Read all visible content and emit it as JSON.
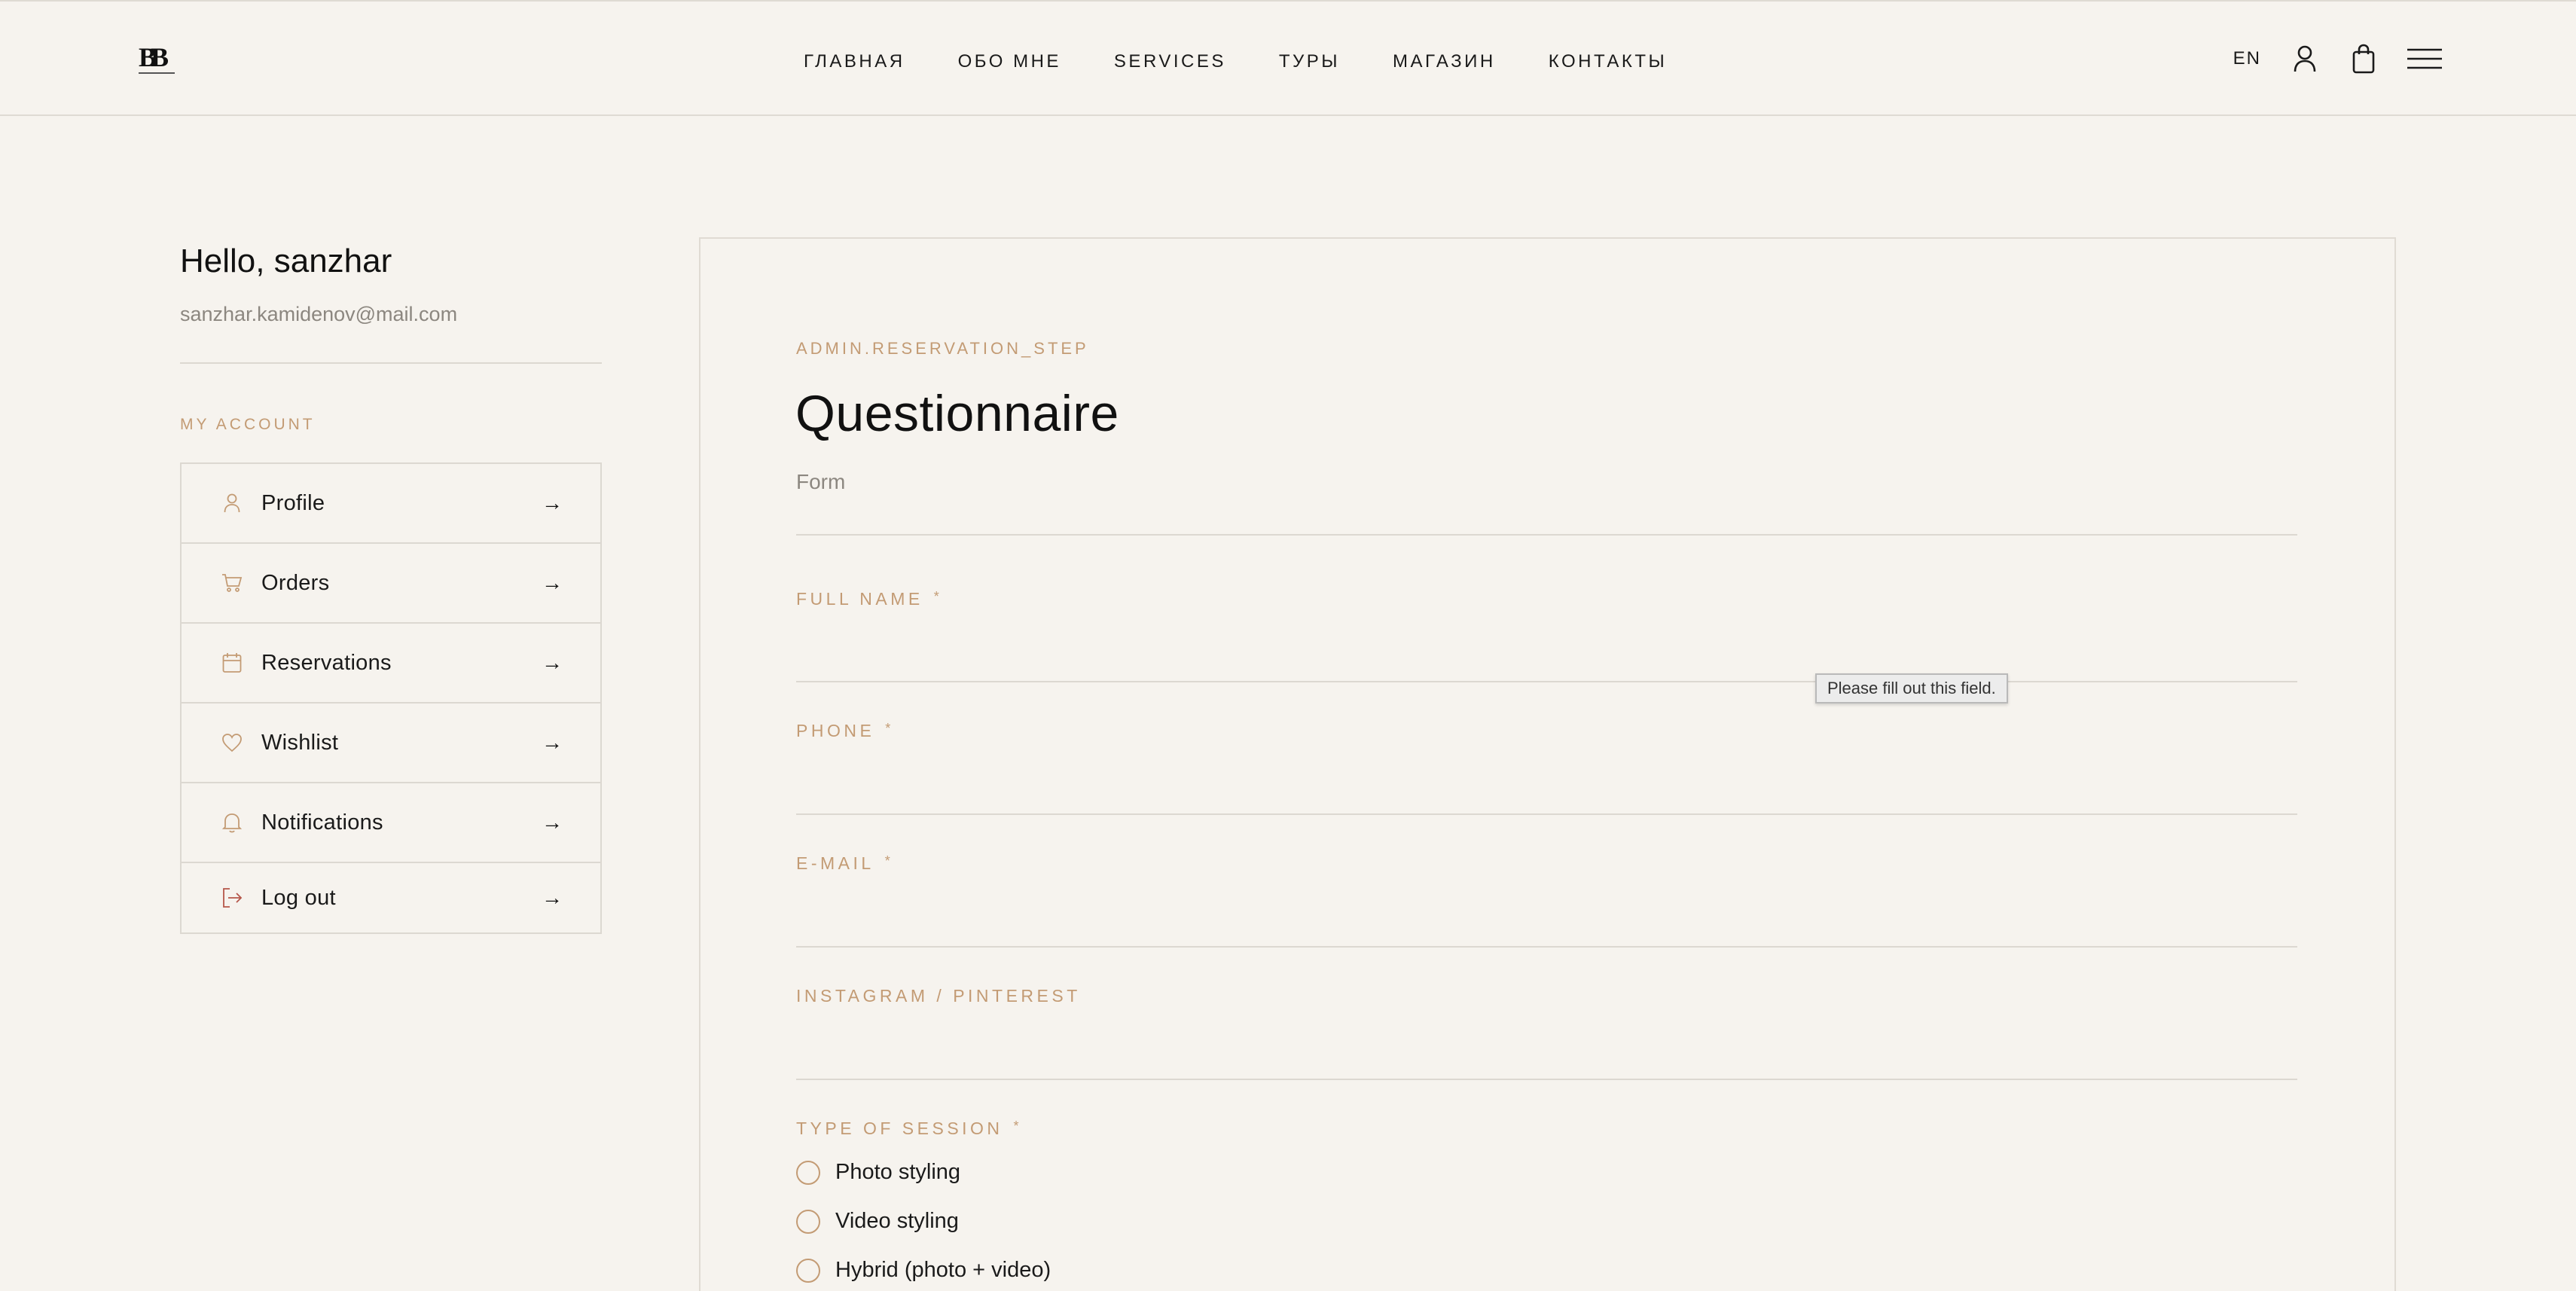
{
  "header": {
    "logo_text": "BB",
    "nav": [
      "ГЛАВНАЯ",
      "ОБО МНЕ",
      "SERVICES",
      "ТУРЫ",
      "МАГАЗИН",
      "КОНТАКТЫ"
    ],
    "lang": "EN",
    "icons": [
      "user-icon",
      "shopping-bag-icon",
      "hamburger-menu-icon"
    ]
  },
  "sidebar": {
    "greeting": "Hello, sanzhar",
    "email": "sanzhar.kamidenov@mail.com",
    "section_label": "MY ACCOUNT",
    "items": [
      {
        "label": "Profile",
        "icon": "user-icon",
        "arrow": "→"
      },
      {
        "label": "Orders",
        "icon": "cart-icon",
        "arrow": "→"
      },
      {
        "label": "Reservations",
        "icon": "calendar-icon",
        "arrow": "→"
      },
      {
        "label": "Wishlist",
        "icon": "heart-icon",
        "arrow": "→"
      },
      {
        "label": "Notifications",
        "icon": "bell-icon",
        "arrow": "→"
      },
      {
        "label": "Log out",
        "icon": "logout-icon",
        "arrow": "→"
      }
    ]
  },
  "form": {
    "eyebrow": "ADMIN.RESERVATION_STEP",
    "title": "Questionnaire",
    "subtitle": "Form",
    "fields": [
      {
        "label": "FULL NAME",
        "required_mark": "*",
        "value": ""
      },
      {
        "label": "PHONE",
        "required_mark": "*",
        "value": ""
      },
      {
        "label": "E-MAIL",
        "required_mark": "*",
        "value": ""
      },
      {
        "label": "INSTAGRAM / PINTEREST",
        "required_mark": "",
        "value": ""
      }
    ],
    "session_type": {
      "label": "TYPE OF SESSION",
      "required_mark": "*",
      "options": [
        "Photo styling",
        "Video styling",
        "Hybrid (photo + video)"
      ]
    },
    "validation_tooltip": "Please fill out this field."
  },
  "colors": {
    "background": "#f6f3ee",
    "accent": "#c39b74",
    "border": "#dcd8d1",
    "text": "#1a1a1a",
    "muted": "#8c8780"
  }
}
